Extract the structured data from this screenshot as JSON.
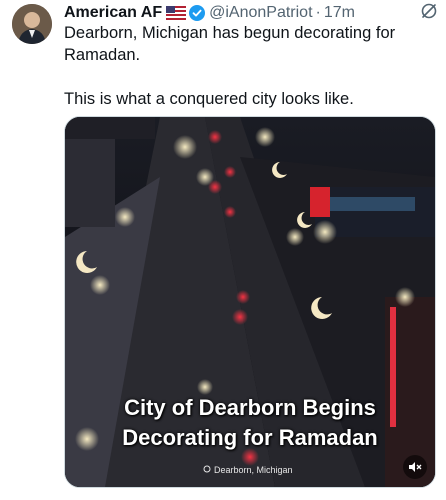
{
  "tweet": {
    "author_name": "American AF",
    "handle": "@iAnonPatriot",
    "separator": "·",
    "time": "17m",
    "text_line1": "Dearborn, Michigan has begun decorating for Ramadan.",
    "text_line2": "This is what a conquered city looks like."
  },
  "media": {
    "caption_line1": "City of Dearborn Begins",
    "caption_line2": "Decorating for Ramadan",
    "location_label": "Dearborn, Michigan"
  },
  "icons": {
    "flag": "us-flag-icon",
    "verified": "verified-badge-icon",
    "grok": "grok-icon",
    "mute": "volume-muted-icon",
    "pin": "location-pin-icon"
  },
  "colors": {
    "text": "#0f1419",
    "secondary": "#536471",
    "verified_blue": "#1d9bf0"
  }
}
